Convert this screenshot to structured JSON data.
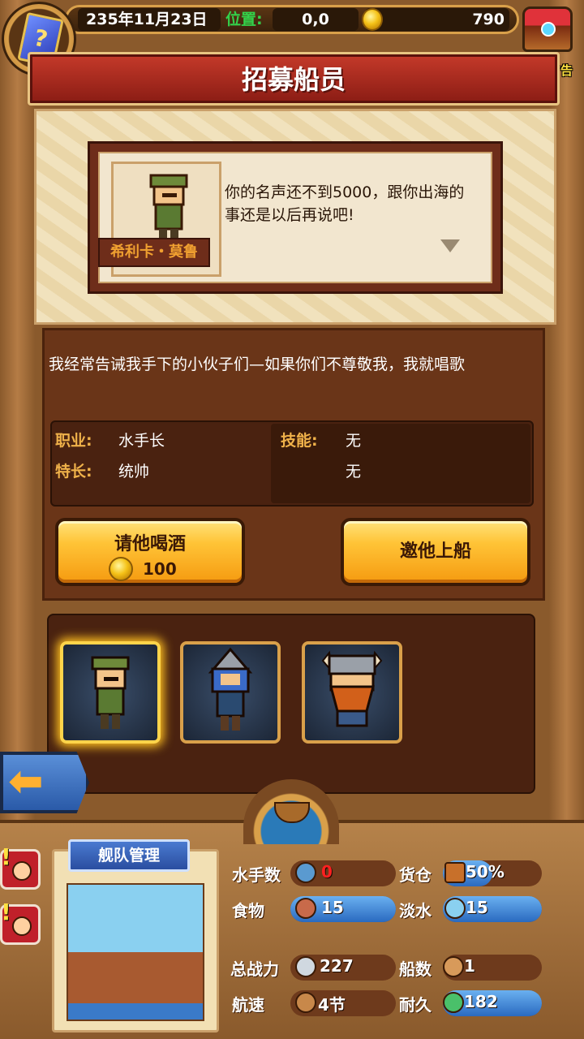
{
  "header": {
    "date": "235年11月23日",
    "position_label": "位置:",
    "position_value": "0,0",
    "gold": "790",
    "ad_label": "有新广告"
  },
  "title": "招募船员",
  "dialog": {
    "npc_name": "希利卡・莫鲁",
    "speech": "你的名声还不到5000，跟你出海的事还是以后再说吧!"
  },
  "crew_info": {
    "bio": "我经常告诫我手下的小伙子们—如果你们不尊敬我，我就唱歌",
    "job_label": "职业:",
    "job_value": "水手长",
    "specialty_label": "特长:",
    "specialty_value": "统帅",
    "skill_label": "技能:",
    "skill_value_1": "无",
    "skill_value_2": "无"
  },
  "buttons": {
    "drink_label": "请他喝酒",
    "drink_cost": "100",
    "invite_label": "邀他上船"
  },
  "crew_slots": [
    {
      "icon": "bandana-sailor-icon",
      "selected": true
    },
    {
      "icon": "helmet-knight-icon",
      "selected": false
    },
    {
      "icon": "viking-dwarf-icon",
      "selected": false
    }
  ],
  "fleet": {
    "tag": "舰队管理",
    "stats": {
      "sailors_label": "水手数",
      "sailors_value": "0",
      "cargo_label": "货仓",
      "cargo_value": "50%",
      "food_label": "食物",
      "food_value": "15",
      "water_label": "淡水",
      "water_value": "15",
      "power_label": "总战力",
      "power_value": "227",
      "ships_label": "船数",
      "ships_value": "1",
      "speed_label": "航速",
      "speed_value": "4节",
      "durability_label": "耐久",
      "durability_value": "182"
    }
  },
  "colors": {
    "accent_gold": "#ffc437",
    "title_red": "#c53a2a",
    "position_green": "#33d14a"
  }
}
